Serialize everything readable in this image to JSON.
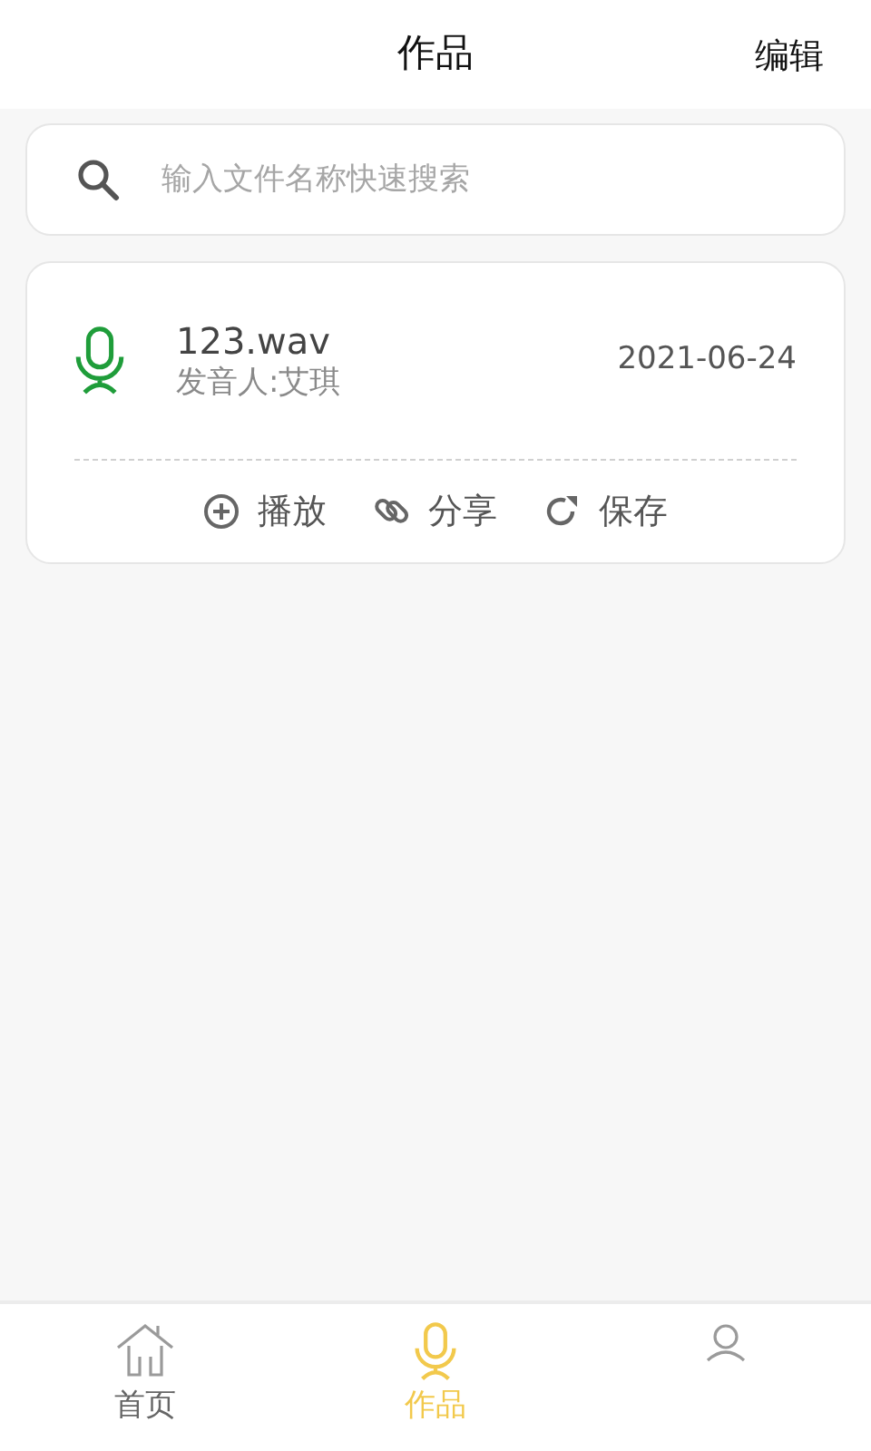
{
  "header": {
    "title": "作品",
    "action": "编辑"
  },
  "search": {
    "placeholder": "输入文件名称快速搜索"
  },
  "works": [
    {
      "name": "123.wav",
      "speaker": "发音人:艾琪",
      "date": "2021-06-24",
      "actions": [
        "播放",
        "分享",
        "保存"
      ]
    }
  ],
  "tabs": [
    {
      "label": "首页",
      "selected": false
    },
    {
      "label": "作品",
      "selected": true
    },
    {
      "selected": false
    }
  ]
}
